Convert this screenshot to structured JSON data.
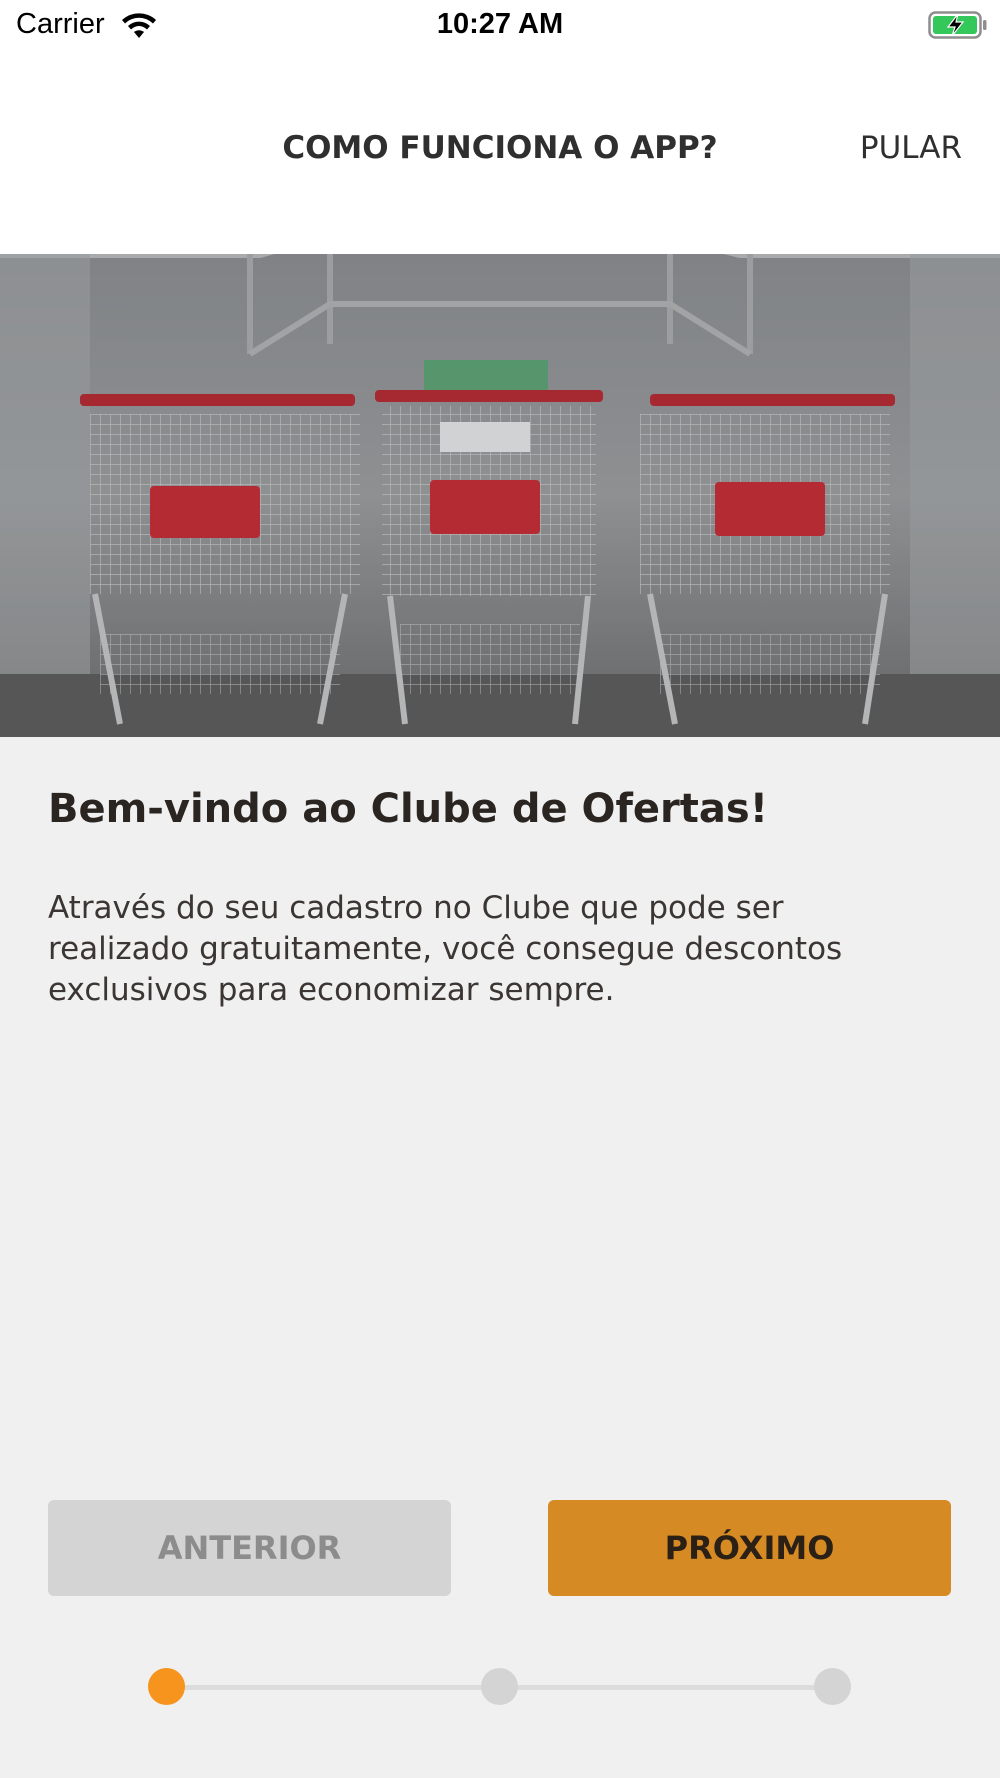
{
  "status_bar": {
    "carrier": "Carrier",
    "time": "10:27 AM",
    "battery_icon": "battery-charging-icon",
    "wifi_icon": "wifi-icon"
  },
  "header": {
    "title": "COMO FUNCIONA O APP?",
    "skip_label": "PULAR"
  },
  "hero": {
    "image": "shopping-carts-photo"
  },
  "content": {
    "title": "Bem-vindo ao Clube de Ofertas!",
    "description": "Através do seu cadastro no Clube que pode ser realizado gratuitamente, você consegue descontos exclusivos para economizar sempre."
  },
  "buttons": {
    "previous_label": "ANTERIOR",
    "next_label": "PRÓXIMO"
  },
  "stepper": {
    "total_steps": 3,
    "current_step": 1
  },
  "colors": {
    "accent": "#d68a23",
    "active_dot": "#f6941d",
    "inactive": "#d4d4d4",
    "background": "#f0f0f0"
  }
}
